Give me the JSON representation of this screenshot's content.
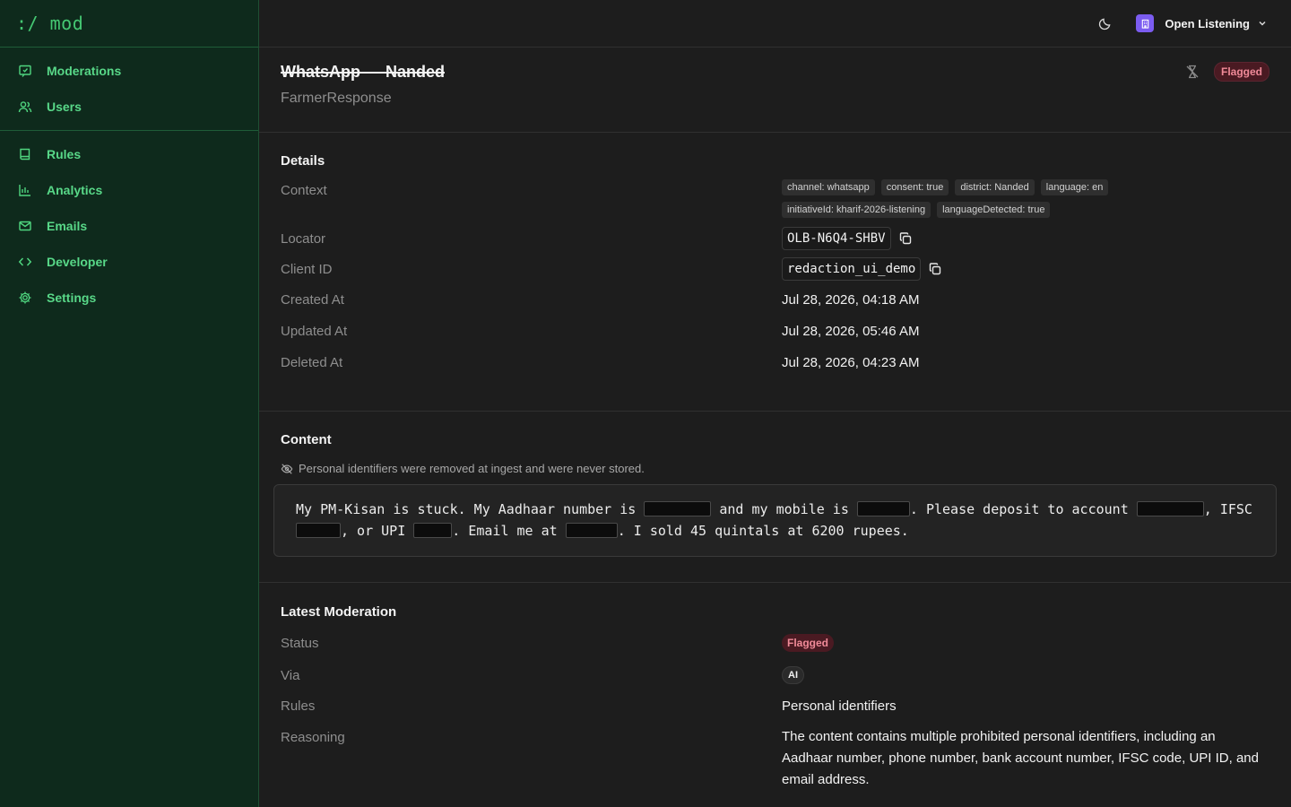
{
  "app": {
    "logo": ":/ mod"
  },
  "sidebar": {
    "primary": [
      {
        "label": "Moderations",
        "icon": "moderation-icon"
      },
      {
        "label": "Users",
        "icon": "users-icon"
      }
    ],
    "secondary": [
      {
        "label": "Rules",
        "icon": "book-icon"
      },
      {
        "label": "Analytics",
        "icon": "chart-icon"
      },
      {
        "label": "Emails",
        "icon": "mail-icon"
      },
      {
        "label": "Developer",
        "icon": "code-icon"
      },
      {
        "label": "Settings",
        "icon": "gear-icon"
      }
    ]
  },
  "topbar": {
    "org_name": "Open Listening",
    "org_color": "#7b5cf0"
  },
  "header": {
    "title": "WhatsApp — Nanded",
    "subtitle": "FarmerResponse",
    "status": "Flagged"
  },
  "details": {
    "title": "Details",
    "context_label": "Context",
    "tags": [
      "channel: whatsapp",
      "consent: true",
      "district: Nanded",
      "language: en",
      "initiativeId: kharif-2026-listening",
      "languageDetected: true"
    ],
    "locator_label": "Locator",
    "locator": "OLB-N6Q4-SHBV",
    "client_id_label": "Client ID",
    "client_id": "redaction_ui_demo",
    "created_label": "Created At",
    "created": "Jul 28, 2026, 04:18 AM",
    "updated_label": "Updated At",
    "updated": "Jul 28, 2026, 05:46 AM",
    "deleted_label": "Deleted At",
    "deleted": "Jul 28, 2026, 04:23 AM"
  },
  "content": {
    "title": "Content",
    "notice": "Personal identifiers were removed at ingest and were never stored.",
    "parts": [
      "My PM-Kisan is stuck. My Aadhaar number is ",
      " and my mobile is ",
      ". Please deposit to account ",
      ", IFSC ",
      ", or UPI ",
      ". Email me at ",
      ". I sold 45 quintals at 6200 rupees."
    ]
  },
  "moderation": {
    "title": "Latest Moderation",
    "status_label": "Status",
    "status": "Flagged",
    "via_label": "Via",
    "via": "AI",
    "rules_label": "Rules",
    "rules": "Personal identifiers",
    "reasoning_label": "Reasoning",
    "reasoning": "The content contains multiple prohibited personal identifiers, including an Aadhaar number, phone number, bank account number, IFSC code, UPI ID, and email address."
  }
}
